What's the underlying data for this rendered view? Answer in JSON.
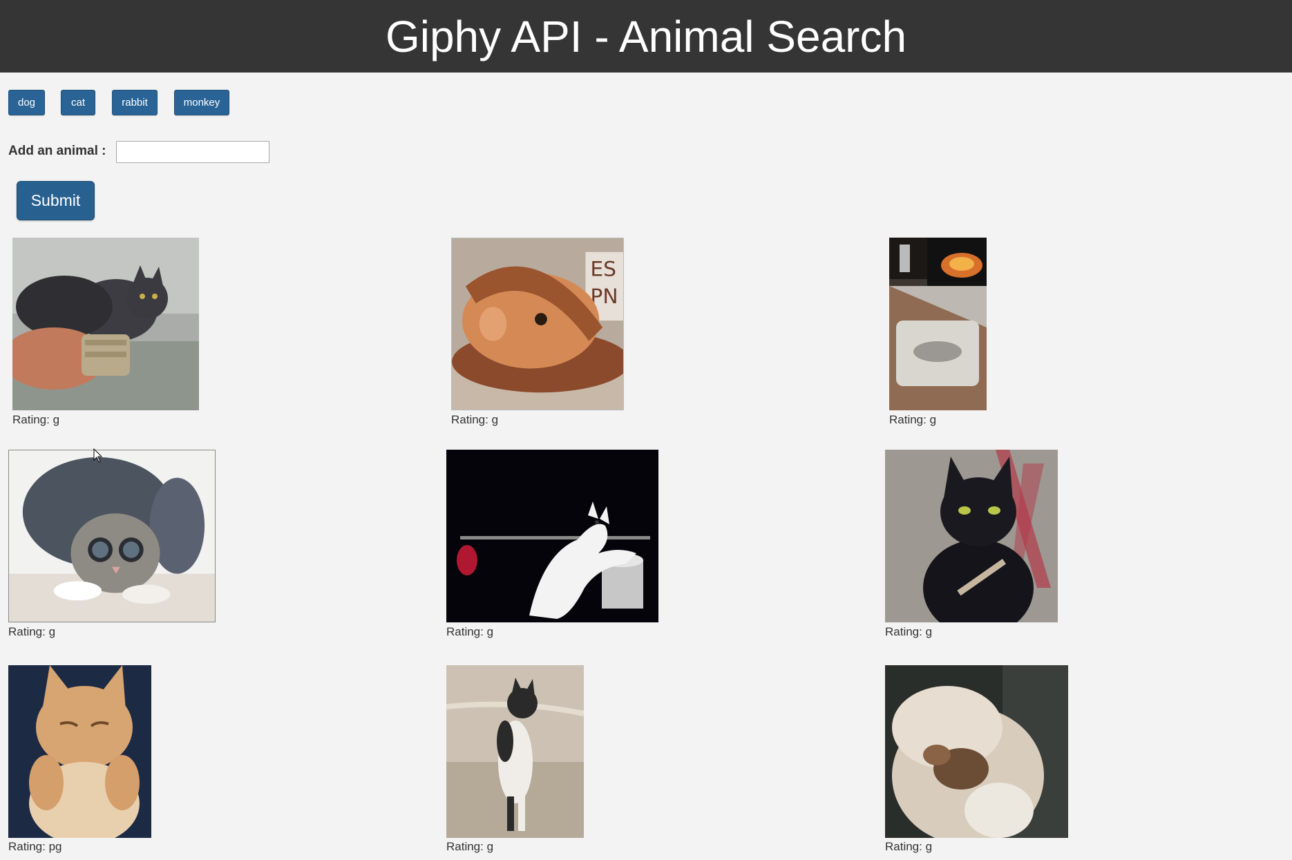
{
  "header": {
    "title": "Giphy API - Animal Search"
  },
  "animal_buttons": [
    "dog",
    "cat",
    "rabbit",
    "monkey"
  ],
  "form": {
    "label": "Add an animal :",
    "input_value": "",
    "submit_label": "Submit"
  },
  "results": [
    {
      "rating": "Rating: g"
    },
    {
      "rating": "Rating: g"
    },
    {
      "rating": "Rating: g"
    },
    {
      "rating": "Rating: g"
    },
    {
      "rating": "Rating: g"
    },
    {
      "rating": "Rating: g"
    },
    {
      "rating": "Rating: pg"
    },
    {
      "rating": "Rating: g"
    },
    {
      "rating": "Rating: g"
    }
  ],
  "colors": {
    "header_bg": "#353535",
    "page_bg": "#f3f3f3",
    "button_bg": "#2a6496"
  }
}
